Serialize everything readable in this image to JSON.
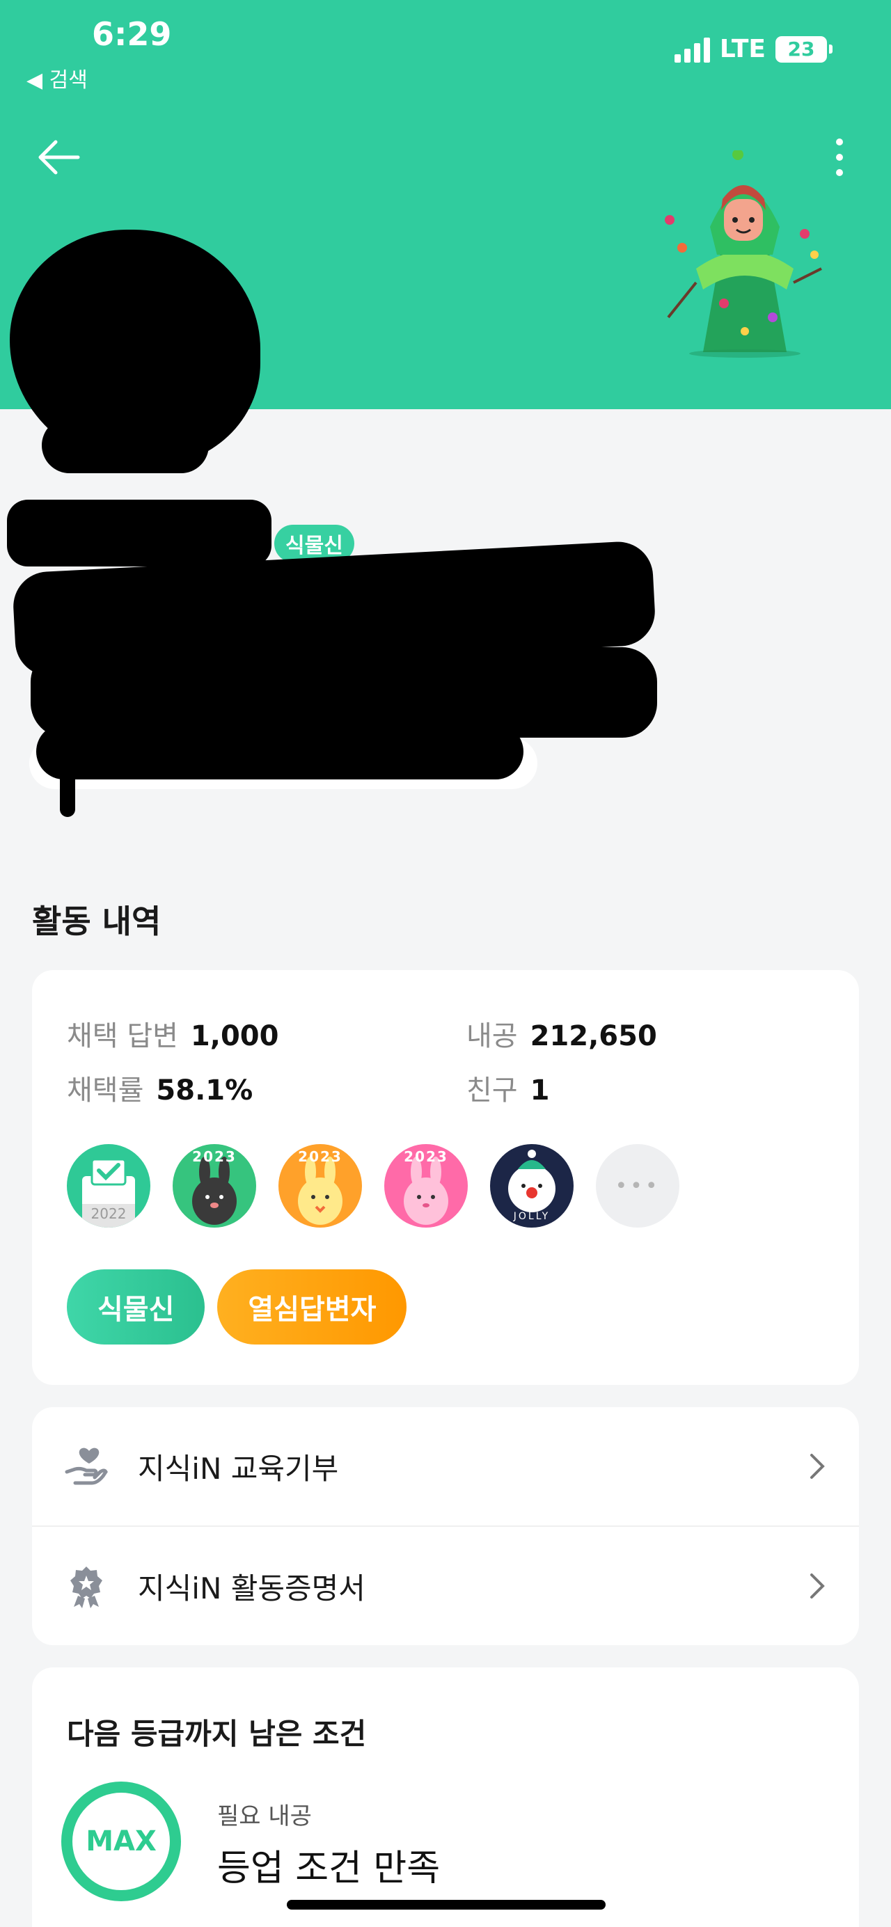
{
  "status_bar": {
    "time": "6:29",
    "back_app": "◀ 검색",
    "network": "LTE",
    "battery": "23"
  },
  "profile": {
    "level_badge": "식물신"
  },
  "activity": {
    "section_title": "활동 내역",
    "stats": [
      {
        "label": "채택 답변",
        "value": "1,000"
      },
      {
        "label": "내공",
        "value": "212,650"
      },
      {
        "label": "채택률",
        "value": "58.1%"
      },
      {
        "label": "친구",
        "value": "1"
      }
    ],
    "badges": [
      {
        "icon": "ballot-box-icon",
        "text": "2022"
      },
      {
        "icon": "black-rabbit-icon",
        "text": "2023"
      },
      {
        "icon": "yellow-rabbit-icon",
        "text": "2023"
      },
      {
        "icon": "pink-rabbit-icon",
        "text": "2023"
      },
      {
        "icon": "snowman-icon",
        "text": "JOLLY"
      },
      {
        "icon": "more-icon",
        "text": "•••"
      }
    ],
    "level_chips": [
      "식물신",
      "열심답변자"
    ]
  },
  "menu": {
    "items": [
      {
        "icon": "hand-heart-icon",
        "label": "지식iN 교육기부"
      },
      {
        "icon": "award-ribbon-icon",
        "label": "지식iN 활동증명서"
      }
    ]
  },
  "next_level": {
    "title": "다음 등급까지 남은 조건",
    "ring_text": "MAX",
    "requirement_label": "필요 내공",
    "requirement_value": "등업 조건 만족"
  },
  "colors": {
    "brand_green": "#30cc9e",
    "chip_orange": "#ff9f10",
    "background": "#f4f5f6"
  }
}
